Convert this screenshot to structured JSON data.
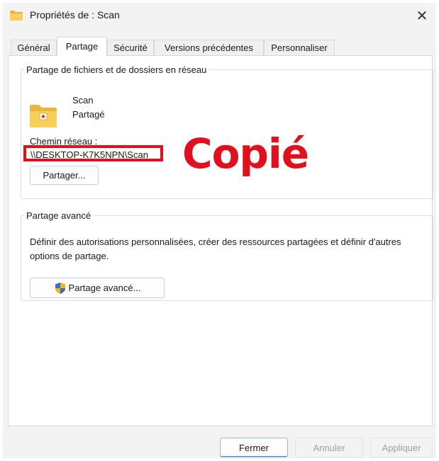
{
  "window": {
    "title": "Propriétés de : Scan",
    "close_glyph": "✕"
  },
  "tabs": [
    {
      "label": "Général",
      "active": false
    },
    {
      "label": "Partage",
      "active": true
    },
    {
      "label": "Sécurité",
      "active": false
    },
    {
      "label": "Versions précédentes",
      "active": false
    },
    {
      "label": "Personnaliser",
      "active": false
    }
  ],
  "network_sharing": {
    "group_title": "Partage de fichiers et de dossiers en réseau",
    "folder_name": "Scan",
    "status": "Partagé",
    "path_label": "Chemin réseau :",
    "path_value": "\\\\DESKTOP-K7K5NPN\\Scan",
    "share_button": "Partager..."
  },
  "annotation": {
    "text": "Copié",
    "color": "#e0101c"
  },
  "advanced_sharing": {
    "group_title": "Partage avancé",
    "description": "Définir des autorisations personnalisées, créer des ressources partagées et définir d'autres options de partage.",
    "button": "Partage avancé...",
    "button_icon": "shield-icon"
  },
  "footer": {
    "close": "Fermer",
    "cancel": "Annuler",
    "apply": "Appliquer"
  },
  "colors": {
    "accent_red": "#e0101c",
    "folder_yellow": "#f4c542"
  }
}
